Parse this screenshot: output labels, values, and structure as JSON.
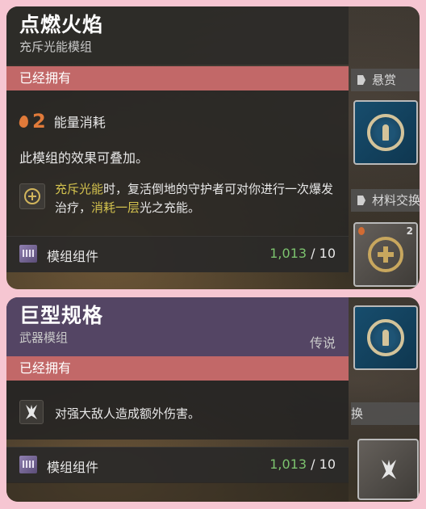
{
  "panel1": {
    "title": "点燃火焰",
    "subtitle": "充斥光能模组",
    "owned": "已经拥有",
    "energy_value": "2",
    "energy_label": "能量消耗",
    "stack_text": "此模组的效果可叠加。",
    "perk": {
      "highlight1": "充斥光能",
      "text1": "时，复活倒地的守护者可对你进行一次爆发治疗，",
      "highlight2": "消耗一层",
      "text2": "光之充能。"
    },
    "component": {
      "label": "模组组件",
      "have": "1,013",
      "need": "/ 10"
    },
    "right": {
      "header1": "悬赏",
      "header2": "材料交换",
      "tile_badge": "2"
    }
  },
  "panel2": {
    "title": "巨型规格",
    "subtitle": "武器模组",
    "rarity": "传说",
    "owned": "已经拥有",
    "perk_text": "对强大敌人造成额外伤害。",
    "component": {
      "label": "模组组件",
      "have": "1,013",
      "need": "/ 10"
    },
    "right": {
      "header1": "换"
    }
  },
  "colors": {
    "owned_bar": "#c26868",
    "legendary_header": "#544564",
    "energy": "#e07a3a",
    "highlight": "#d3c24e",
    "have_count": "#7cc36e"
  },
  "icons": [
    "flame-icon",
    "charged-light-perk-icon",
    "damage-perk-icon",
    "mod-components-icon",
    "bounty-tile-icon",
    "healing-mod-tile-icon"
  ]
}
